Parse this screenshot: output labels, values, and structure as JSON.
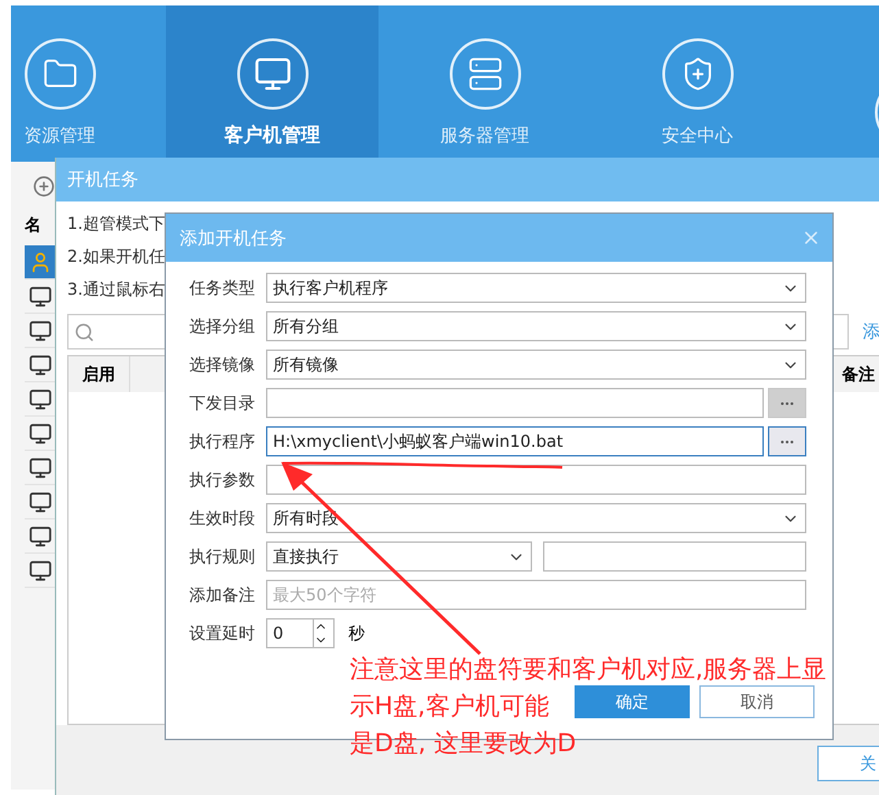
{
  "nav": {
    "items": [
      {
        "label": "资源管理",
        "kind": "folder",
        "selected": false
      },
      {
        "label": "客户机管理",
        "kind": "monitor",
        "selected": true
      },
      {
        "label": "服务器管理",
        "kind": "server",
        "selected": false
      },
      {
        "label": "安全中心",
        "kind": "shield",
        "selected": false
      },
      {
        "kind": "partial",
        "selected": false
      }
    ]
  },
  "sidebar": {
    "header": "名",
    "rows": [
      {
        "kind": "user",
        "selected": true
      },
      {
        "kind": "monitor",
        "selected": false
      },
      {
        "kind": "monitor",
        "selected": false
      },
      {
        "kind": "monitor",
        "selected": false
      },
      {
        "kind": "monitor",
        "selected": false
      },
      {
        "kind": "monitor",
        "selected": false
      },
      {
        "kind": "monitor",
        "selected": false
      },
      {
        "kind": "monitor",
        "selected": false
      },
      {
        "kind": "monitor",
        "selected": false
      },
      {
        "kind": "monitor",
        "selected": false
      }
    ]
  },
  "task_window": {
    "title": "开机任务",
    "notes": [
      "1.超管模式下",
      "2.如果开机任",
      "3.通过鼠标右"
    ],
    "link": "添",
    "table": {
      "columns": [
        "启用",
        "备注"
      ]
    },
    "close_button": "关"
  },
  "dialog": {
    "title": "添加开机任务",
    "fields": [
      {
        "label": "任务类型",
        "kind": "select",
        "value": "执行客户机程序"
      },
      {
        "label": "选择分组",
        "kind": "select",
        "value": "所有分组"
      },
      {
        "label": "选择镜像",
        "kind": "select",
        "value": "所有镜像"
      },
      {
        "label": "下发目录",
        "kind": "browse",
        "focused": false
      },
      {
        "label": "执行程序",
        "kind": "browse",
        "value": "H:\\xmyclient\\小蚂蚁客户端win10.bat",
        "focused": true
      },
      {
        "label": "执行参数",
        "kind": "input"
      },
      {
        "label": "生效时段",
        "kind": "select",
        "value": "所有时段"
      },
      {
        "label": "执行规则",
        "kind": "select_pair",
        "value": "直接执行"
      },
      {
        "label": "添加备注",
        "kind": "input",
        "placeholder": "最大50个字符"
      },
      {
        "label": "设置延时",
        "kind": "spinner",
        "value": "0",
        "unit": "秒"
      }
    ],
    "buttons": [
      {
        "label": "确定",
        "kind": "primary"
      },
      {
        "label": "取消",
        "kind": "secondary"
      }
    ]
  },
  "annotation": {
    "lines": [
      "注意这里的盘符要和客户机对应,服务器上显",
      "示H盘,客户机可能",
      "是D盘, 这里要改为D"
    ]
  }
}
